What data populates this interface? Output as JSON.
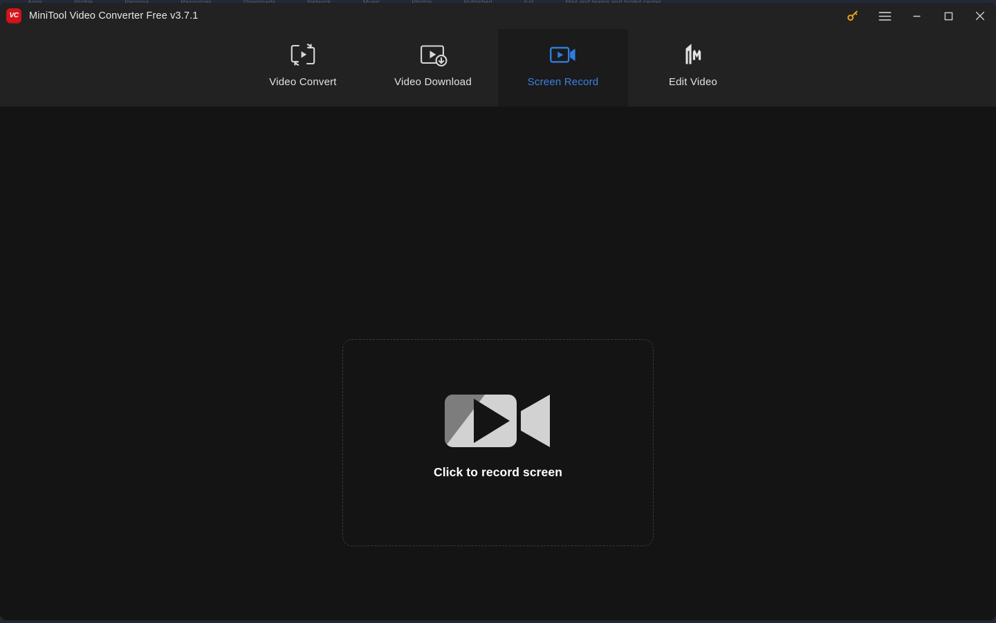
{
  "backdrop": {
    "bookmark_items": [
      "Apps",
      "Profile",
      "Persona",
      "Resources",
      "Downloads",
      "Network",
      "Music",
      "Photos",
      "Published",
      "Ext",
      "Mail and teams and toolkit center"
    ]
  },
  "titlebar": {
    "logo_text": "VC",
    "title": "MiniTool Video Converter Free v3.7.1",
    "controls": [
      {
        "name": "key-icon",
        "label": "Register"
      },
      {
        "name": "hamburger-menu-icon",
        "label": "Menu"
      },
      {
        "name": "minimize-icon",
        "label": "Minimize"
      },
      {
        "name": "maximize-icon",
        "label": "Maximize"
      },
      {
        "name": "close-icon",
        "label": "Close"
      }
    ]
  },
  "nav": {
    "tabs": [
      {
        "label": "Video Convert",
        "icon": "video-convert-icon",
        "active": false
      },
      {
        "label": "Video Download",
        "icon": "video-download-icon",
        "active": false
      },
      {
        "label": "Screen Record",
        "icon": "screen-record-icon",
        "active": true
      },
      {
        "label": "Edit Video",
        "icon": "edit-video-icon",
        "active": false
      }
    ]
  },
  "main": {
    "dropzone": {
      "icon": "camcorder-icon",
      "label": "Click to record screen"
    }
  },
  "colors": {
    "accent_blue": "#3b82e8",
    "logo_red": "#d4161c",
    "key_orange": "#e8a317",
    "window_bg": "#141414",
    "header_bg": "#222222",
    "active_tab_bg": "#1b1b1b",
    "dashed_border": "#3b3b3b",
    "icon_light": "#d2d2d2",
    "icon_mid": "#7d7d7d"
  }
}
